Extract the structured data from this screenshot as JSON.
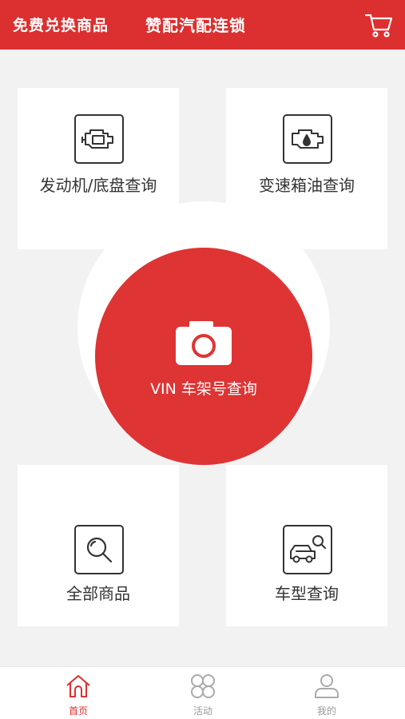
{
  "header": {
    "left_title": "免费兑换商品",
    "center_title": "赞配汽配连锁",
    "cart_icon": "cart-icon"
  },
  "cards": {
    "engine": {
      "label": "发动机/底盘查询",
      "icon": "engine-icon"
    },
    "oil": {
      "label": "变速箱油查询",
      "icon": "oil-engine-icon"
    },
    "all_goods": {
      "label": "全部商品",
      "icon": "search-icon"
    },
    "car_model": {
      "label": "车型查询",
      "icon": "car-search-icon"
    }
  },
  "vin": {
    "label": "VIN 车架号查询",
    "icon": "camera-icon"
  },
  "tabs": [
    {
      "label": "首页",
      "icon": "home-icon",
      "active": true
    },
    {
      "label": "活动",
      "icon": "clover-icon",
      "active": false
    },
    {
      "label": "我的",
      "icon": "user-icon",
      "active": false
    }
  ],
  "colors": {
    "brand": "#dc2f2f",
    "background": "#f2f2f2",
    "text": "#333333",
    "inactive": "#999999"
  }
}
